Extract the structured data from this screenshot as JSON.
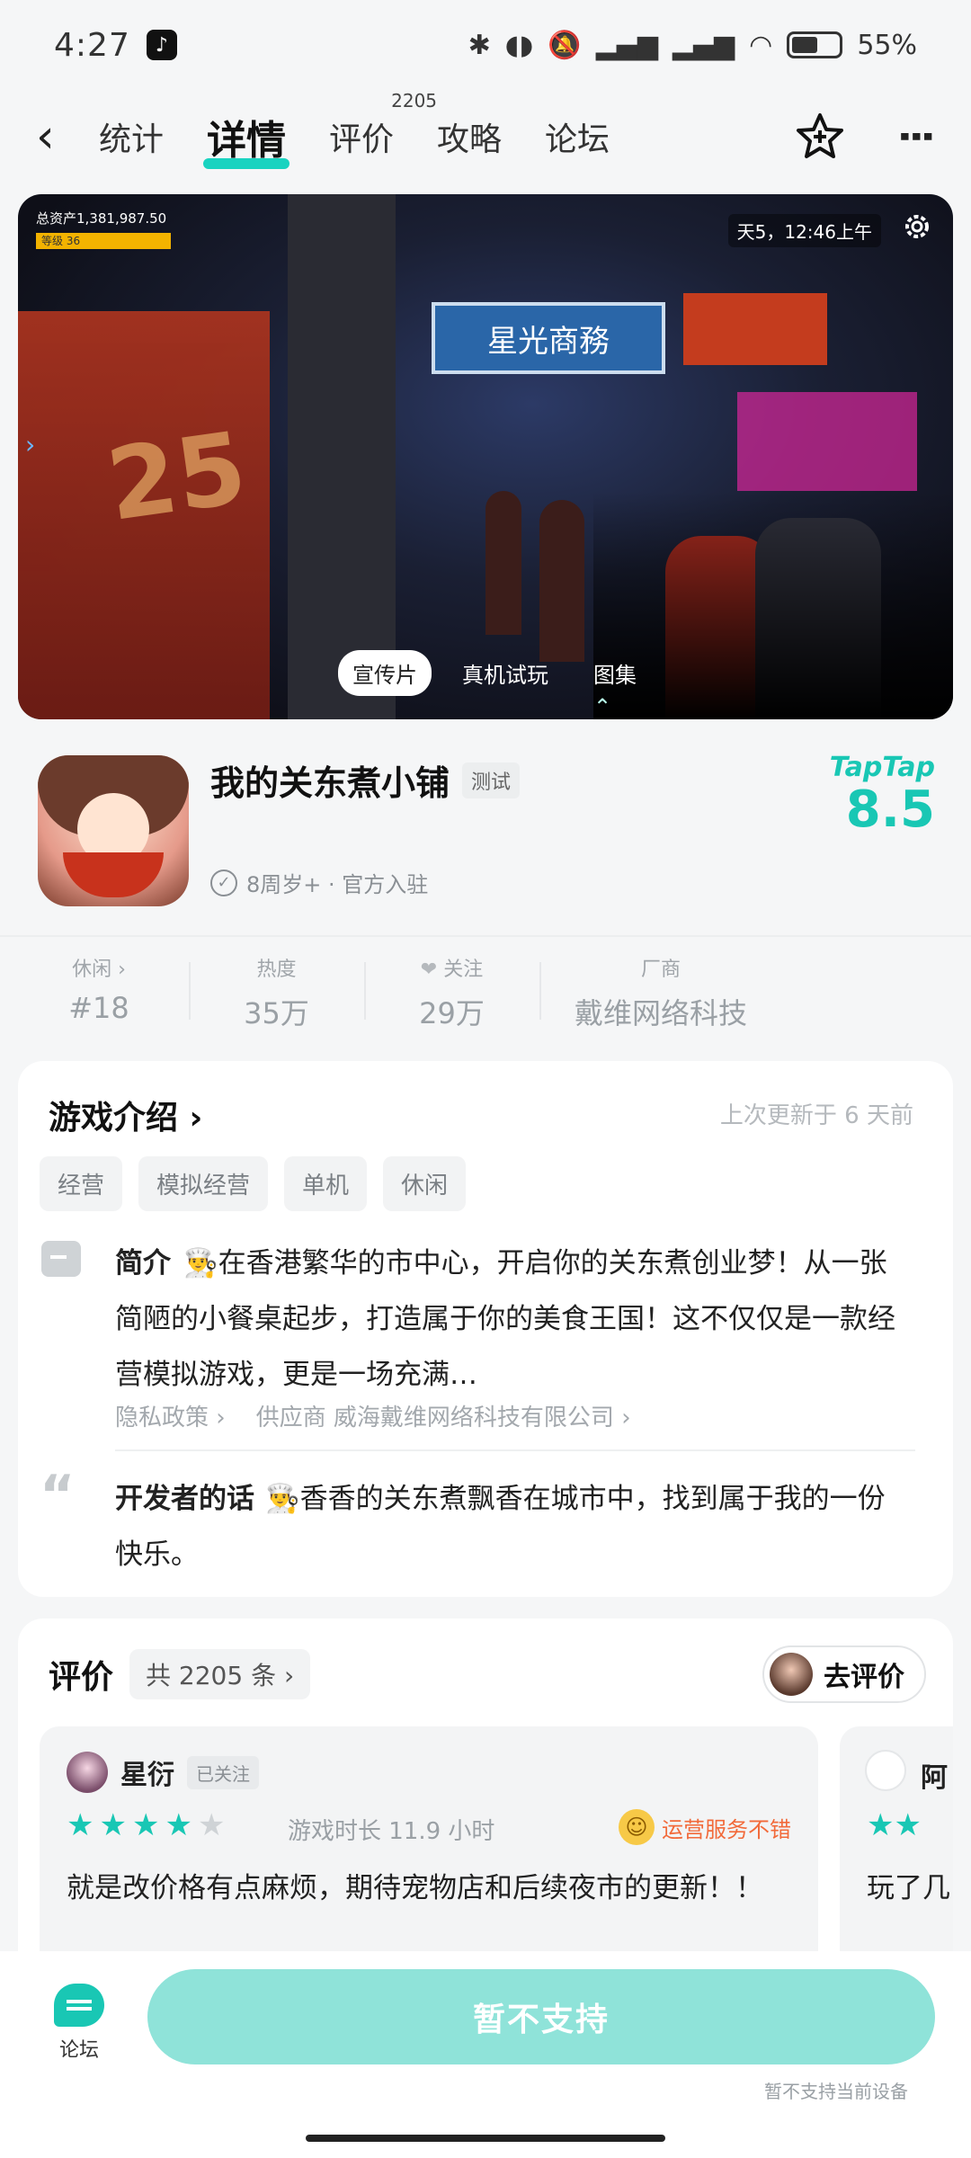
{
  "status": {
    "time": "4:27",
    "battery": "55%",
    "battery_level": 0.55
  },
  "nav": {
    "tabs": [
      {
        "label": "统计"
      },
      {
        "label": "详情",
        "active": true
      },
      {
        "label": "评价",
        "badge": "2205"
      },
      {
        "label": "攻略"
      },
      {
        "label": "论坛"
      }
    ]
  },
  "media": {
    "hud_assets": "总资产1,381,987.50",
    "hud_level": "等级 36",
    "hud_time": "天5，12:46上午",
    "sign_text": "星光商務",
    "bus_number": "25",
    "tabs": [
      "宣传片",
      "真机试玩",
      "图集"
    ]
  },
  "app": {
    "title": "我的关东煮小铺",
    "tag": "测试",
    "subtitle": "8周岁+ · 官方入驻",
    "rating_brand": "TapTap",
    "rating": "8.5"
  },
  "stats": [
    {
      "label": "休闲 ›",
      "value": "#18"
    },
    {
      "label": "热度",
      "value": "35万"
    },
    {
      "label": "关注",
      "value": "29万"
    },
    {
      "label": "厂商",
      "value": "戴维网络科技"
    }
  ],
  "intro": {
    "heading": "游戏介绍 ›",
    "updated": "上次更新于 6 天前",
    "chips": [
      "经营",
      "模拟经营",
      "单机",
      "休闲"
    ],
    "summary_label": "简介",
    "summary": "👨‍🍳在香港繁华的市中心，开启你的关东煮创业梦！从一张简陋的小餐桌起步，打造属于你的美食王国！这不仅仅是一款经营模拟游戏，更是一场充满…",
    "privacy": "隐私政策 ›",
    "supplier": "供应商 威海戴维网络科技有限公司 ›",
    "dev_label": "开发者的话",
    "dev_text": "👨‍🍳香香的关东煮飘香在城市中，找到属于我的一份快乐。"
  },
  "reviews": {
    "title": "评价",
    "count": "共 2205 条 ›",
    "go_review": "去评价",
    "items": [
      {
        "user": "星衍",
        "followed": "已关注",
        "stars": 4,
        "playtime": "游戏时长 11.9 小时",
        "tag": "运营服务不错",
        "text": "就是改价格有点麻烦，期待宠物店和后续夜市的更新！！"
      },
      {
        "user": "阿",
        "stars": 2,
        "text": "玩了几 奇就是"
      }
    ]
  },
  "bottom": {
    "forum_label": "论坛",
    "cta": "暂不支持",
    "cta_note": "暂不支持当前设备"
  },
  "colors": {
    "accent": "#19c7b4",
    "cta_disabled": "#8fe3d9",
    "service_tag": "#f26a3a"
  }
}
